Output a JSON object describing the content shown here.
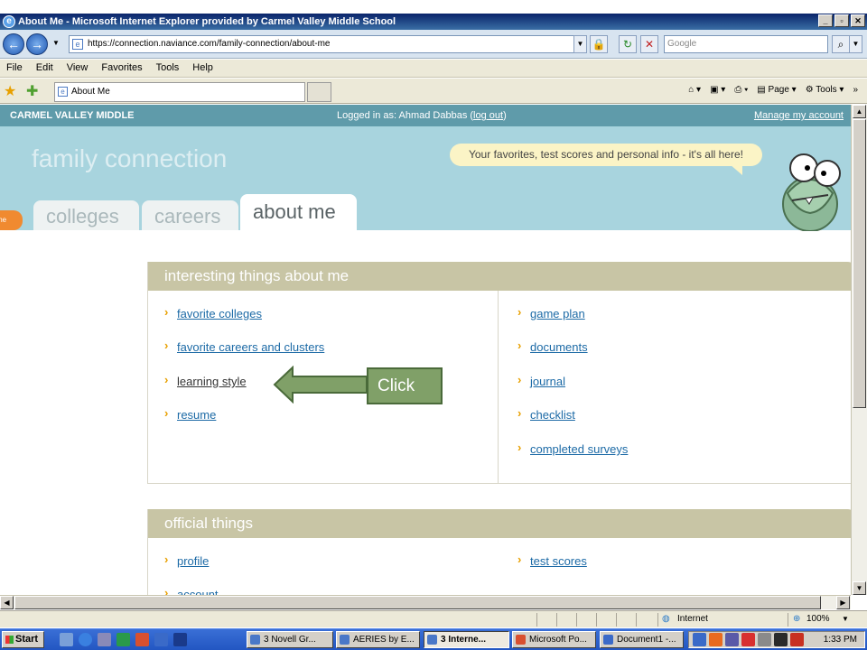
{
  "window": {
    "title": "About Me - Microsoft Internet Explorer provided by Carmel Valley Middle School",
    "url": "https://connection.naviance.com/family-connection/about-me",
    "search_placeholder": "Google",
    "tab_title": "About Me",
    "menu": [
      "File",
      "Edit",
      "View",
      "Favorites",
      "Tools",
      "Help"
    ],
    "cmd": {
      "page": "Page",
      "tools": "Tools"
    }
  },
  "site": {
    "school": "CARMEL VALLEY MIDDLE",
    "logged_in_prefix": "Logged in as: Ahmad Dabbas (",
    "logout": "log out",
    "logged_in_suffix": ")",
    "manage_account": "Manage my account",
    "brand": "family connection",
    "bubble": "Your favorites, test scores and personal info - it's all here!",
    "tabs": {
      "home": "me",
      "colleges": "colleges",
      "careers": "careers",
      "about": "about me"
    }
  },
  "interesting": {
    "title": "interesting things about me",
    "left": [
      "favorite colleges",
      "favorite careers and clusters",
      "learning style",
      "resume"
    ],
    "right": [
      "game plan",
      "documents",
      "journal",
      "checklist",
      "completed surveys"
    ]
  },
  "official": {
    "title": "official things",
    "left": [
      "profile",
      "account"
    ],
    "right": [
      "test scores"
    ]
  },
  "callout": {
    "label": "Click"
  },
  "status": {
    "zone": "Internet",
    "zoom": "100%"
  },
  "taskbar": {
    "start": "Start",
    "tasks": [
      "3 Novell Gr...",
      "AERIES by E...",
      "3 Interne...",
      "Microsoft Po...",
      "Document1 -..."
    ],
    "time": "1:33 PM"
  },
  "colors": {
    "accent": "#5f9baa",
    "banner": "#a8d4de",
    "panel_head": "#c8c5a5",
    "link": "#1c6aa6",
    "chevron": "#e8a000"
  }
}
